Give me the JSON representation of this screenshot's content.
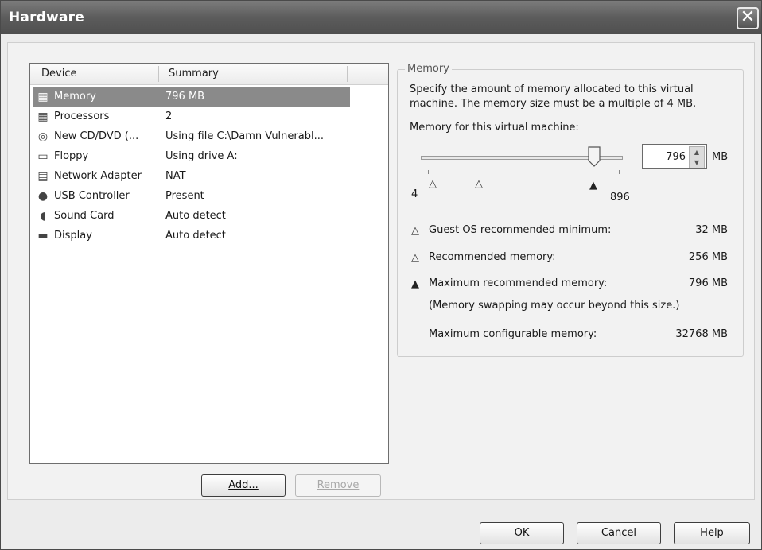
{
  "window": {
    "title": "Hardware"
  },
  "device_list": {
    "columns": [
      "Device",
      "Summary"
    ],
    "rows": [
      {
        "icon": "memory-chip-icon",
        "device": "Memory",
        "summary": "796 MB",
        "selected": true
      },
      {
        "icon": "processor-icon",
        "device": "Processors",
        "summary": "2"
      },
      {
        "icon": "cd-dvd-icon",
        "device": "New CD/DVD (...",
        "summary": "Using file C:\\Damn Vulnerabl..."
      },
      {
        "icon": "floppy-icon",
        "device": "Floppy",
        "summary": "Using drive A:"
      },
      {
        "icon": "network-adapter-icon",
        "device": "Network Adapter",
        "summary": "NAT"
      },
      {
        "icon": "usb-icon",
        "device": "USB Controller",
        "summary": "Present"
      },
      {
        "icon": "sound-icon",
        "device": "Sound Card",
        "summary": "Auto detect"
      },
      {
        "icon": "display-icon",
        "device": "Display",
        "summary": "Auto detect"
      }
    ]
  },
  "list_buttons": {
    "add": "Add...",
    "remove": "Remove"
  },
  "memory": {
    "group_label": "Memory",
    "description_line1": "Specify the amount of memory allocated to this virtual",
    "description_line2": "machine. The memory size must be a multiple of 4 MB.",
    "field_label": "Memory for this virtual machine:",
    "value": "796",
    "unit": "MB",
    "slider_min_label": "4",
    "slider_max_label": "896",
    "slider_level_fraction": 0.89,
    "guest_min_label": "Guest OS recommended minimum:",
    "guest_min_value": "32 MB",
    "recommended_label": "Recommended memory:",
    "recommended_value": "256 MB",
    "max_recommended_label": "Maximum recommended memory:",
    "max_recommended_value": "796 MB",
    "swap_note": "(Memory swapping may occur beyond this size.)",
    "max_config_label": "Maximum configurable memory:",
    "max_config_value": "32768 MB"
  },
  "footer": {
    "ok": "OK",
    "cancel": "Cancel",
    "help": "Help"
  },
  "colors": {
    "titlebar": "#5c5c5c",
    "selection": "#8a8a8a",
    "panel": "#f2f2f2"
  }
}
